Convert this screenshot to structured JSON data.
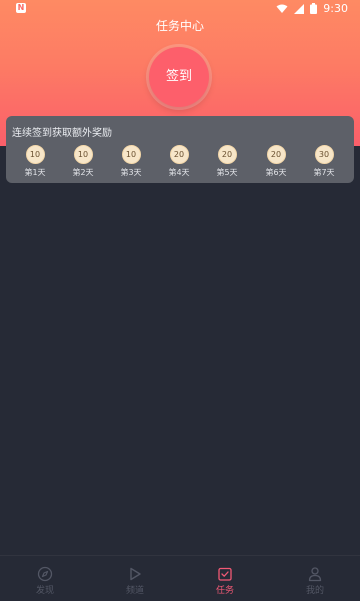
{
  "status_bar": {
    "time": "9:30",
    "app_icon": "N"
  },
  "header": {
    "title": "任务中心",
    "checkin_label": "签到"
  },
  "reward": {
    "title": "连续签到获取额外奖励",
    "days": [
      {
        "coins": "10",
        "label": "第1天"
      },
      {
        "coins": "10",
        "label": "第2天"
      },
      {
        "coins": "10",
        "label": "第3天"
      },
      {
        "coins": "20",
        "label": "第4天"
      },
      {
        "coins": "20",
        "label": "第5天"
      },
      {
        "coins": "20",
        "label": "第6天"
      },
      {
        "coins": "30",
        "label": "第7天"
      }
    ]
  },
  "nav": {
    "items": [
      {
        "label": "发现",
        "icon": "compass-icon"
      },
      {
        "label": "频道",
        "icon": "play-icon"
      },
      {
        "label": "任务",
        "icon": "task-icon"
      },
      {
        "label": "我的",
        "icon": "user-icon"
      }
    ],
    "active": "任务",
    "active_color": "#f15975"
  },
  "colors": {
    "header_top": "#fe8a63",
    "header_bottom": "#fb5f6a",
    "background": "#262a36"
  }
}
